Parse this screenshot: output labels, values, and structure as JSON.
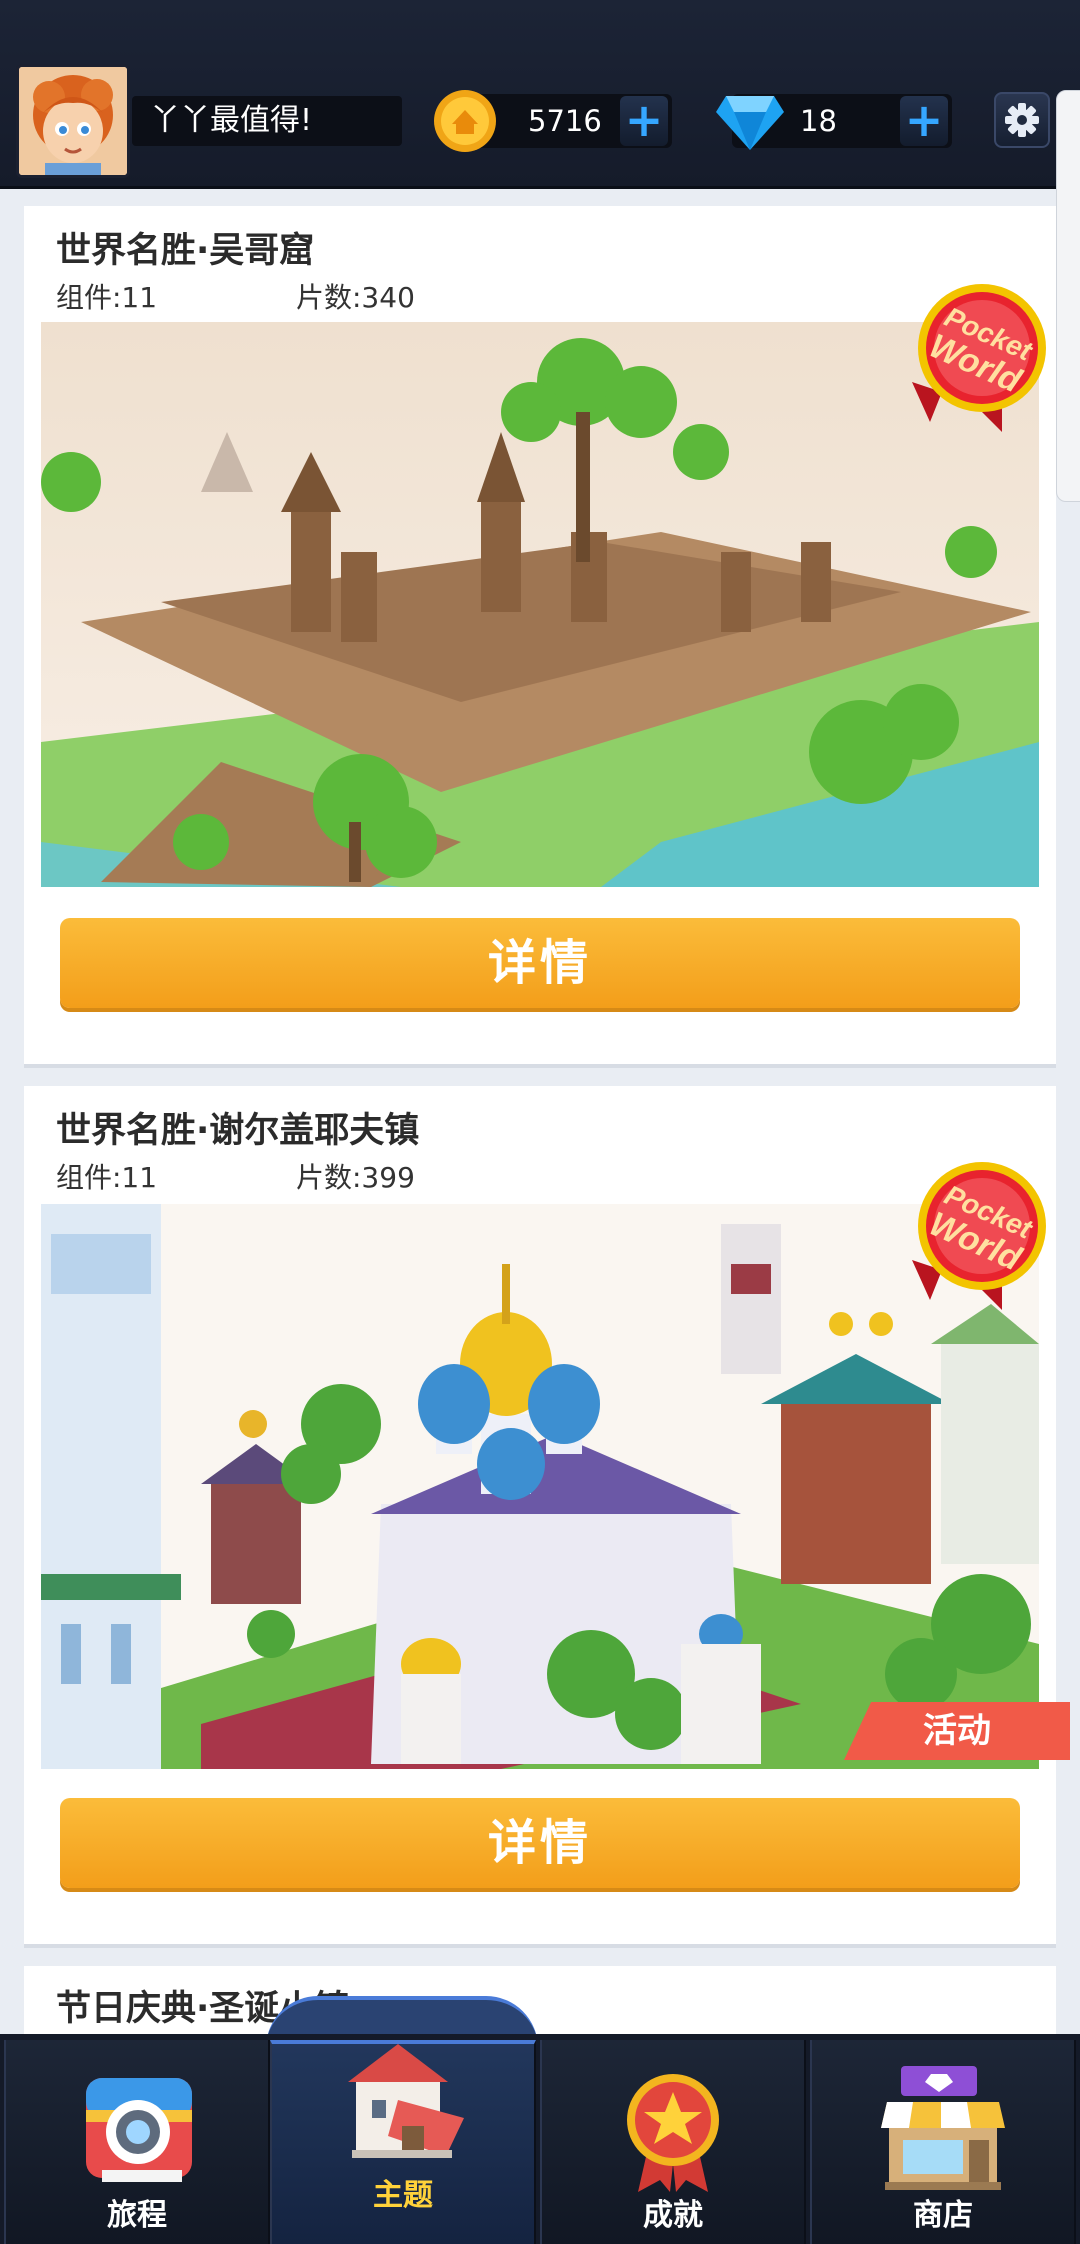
{
  "header": {
    "player_name": "丫丫最值得!",
    "coins": "5716",
    "gems": "18",
    "plus": "+"
  },
  "cards": [
    {
      "title": "世界名胜·吴哥窟",
      "components": "组件:11",
      "pieces": "片数:340",
      "badge": [
        "Pocket",
        "World"
      ],
      "detail_label": "详情"
    },
    {
      "title": "世界名胜·谢尔盖耶夫镇",
      "components": "组件:11",
      "pieces": "片数:399",
      "badge": [
        "Pocket",
        "World"
      ],
      "event_tag": "活动",
      "detail_label": "详情"
    },
    {
      "title": "节日庆典·圣诞小镇"
    }
  ],
  "nav": [
    {
      "label": "旅程",
      "icon": "camera-icon"
    },
    {
      "label": "主题",
      "icon": "house-icon"
    },
    {
      "label": "成就",
      "icon": "medal-icon"
    },
    {
      "label": "商店",
      "icon": "shop-icon"
    }
  ],
  "colors": {
    "topbar": "#1c2436",
    "button": "#f6a623",
    "badge": "#e8232e",
    "event": "#f15a48",
    "active_nav_label": "#ffd23a"
  }
}
